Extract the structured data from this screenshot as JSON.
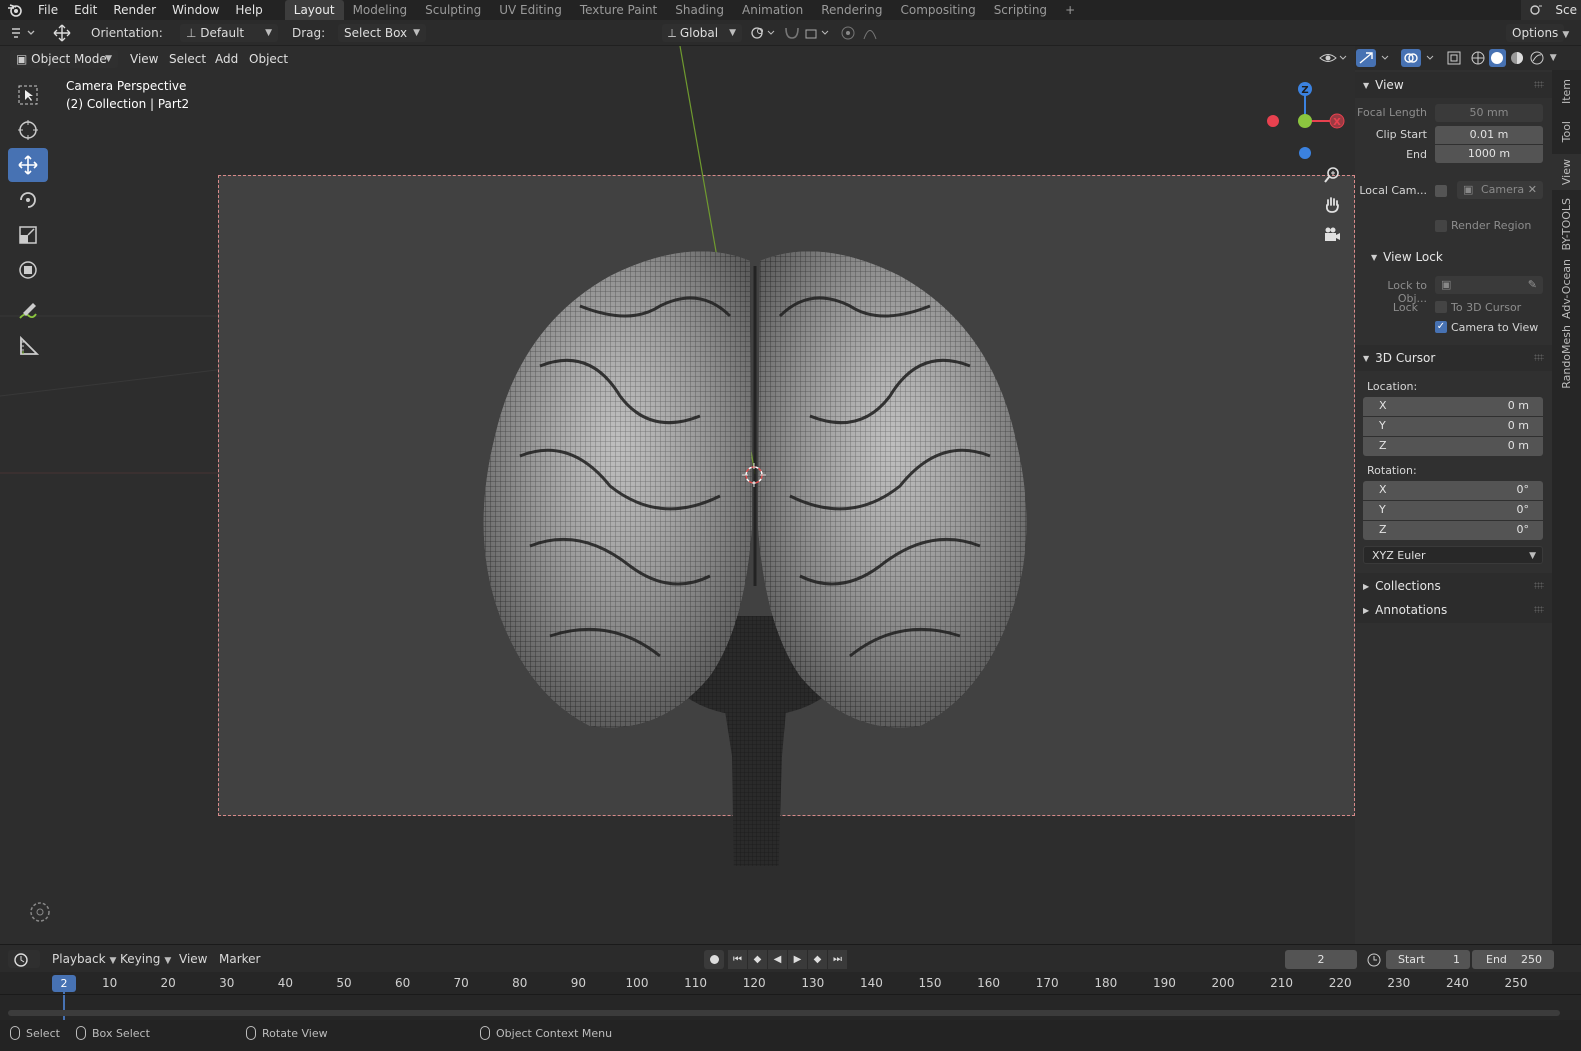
{
  "topbar": {
    "menus": [
      "File",
      "Edit",
      "Render",
      "Window",
      "Help"
    ],
    "workspace_tabs": [
      "Layout",
      "Modeling",
      "Sculpting",
      "UV Editing",
      "Texture Paint",
      "Shading",
      "Animation",
      "Rendering",
      "Compositing",
      "Scripting"
    ],
    "active_tab": "Layout",
    "scene_label": "Sce"
  },
  "toolheader": {
    "orientation_label": "Orientation:",
    "orientation_value": "Default",
    "drag_label": "Drag:",
    "drag_value": "Select Box",
    "transform_orientation": "Global",
    "options_label": "Options"
  },
  "viewport_header": {
    "mode": "Object Mode",
    "menus": [
      "View",
      "Select",
      "Add",
      "Object"
    ]
  },
  "viewport": {
    "overlay_line1": "Camera Perspective",
    "overlay_line2": "(2) Collection | Part2",
    "gizmo_axes": [
      "Z",
      "X"
    ]
  },
  "sidebar": {
    "view_panel": {
      "title": "View",
      "focal_length_label": "Focal Length",
      "focal_length_value": "50 mm",
      "clip_start_label": "Clip Start",
      "clip_start_value": "0.01 m",
      "end_label": "End",
      "end_value": "1000 m",
      "local_camera_label": "Local Cam...",
      "local_camera_value": "Camera",
      "render_region_label": "Render Region"
    },
    "view_lock": {
      "title": "View Lock",
      "lock_to_object_label": "Lock to Obj...",
      "lock_label": "Lock",
      "to_3d_cursor_label": "To 3D Cursor",
      "camera_to_view_label": "Camera to View",
      "camera_to_view_checked": true
    },
    "cursor_panel": {
      "title": "3D Cursor",
      "location_label": "Location:",
      "location": [
        {
          "axis": "X",
          "value": "0 m"
        },
        {
          "axis": "Y",
          "value": "0 m"
        },
        {
          "axis": "Z",
          "value": "0 m"
        }
      ],
      "rotation_label": "Rotation:",
      "rotation": [
        {
          "axis": "X",
          "value": "0°"
        },
        {
          "axis": "Y",
          "value": "0°"
        },
        {
          "axis": "Z",
          "value": "0°"
        }
      ],
      "rotation_mode": "XYZ Euler"
    },
    "collapsed_panels": [
      "Collections",
      "Annotations"
    ]
  },
  "side_tabs": [
    "Item",
    "Tool",
    "View",
    "BY-TOOLS",
    "Adv-Ocean",
    "RandoMesh"
  ],
  "timeline_header": {
    "menus": [
      "Playback",
      "Keying",
      "View",
      "Marker"
    ],
    "current_frame": "2",
    "start_label": "Start",
    "start_value": "1",
    "end_label": "End",
    "end_value": "250"
  },
  "timeline": {
    "current_frame_badge": "2",
    "ticks": [
      "10",
      "20",
      "30",
      "40",
      "50",
      "60",
      "70",
      "80",
      "90",
      "100",
      "110",
      "120",
      "130",
      "140",
      "150",
      "160",
      "170",
      "180",
      "190",
      "200",
      "210",
      "220",
      "230",
      "240",
      "250"
    ]
  },
  "statusbar": {
    "select": "Select",
    "box_select": "Box Select",
    "rotate_view": "Rotate View",
    "context_menu": "Object Context Menu"
  },
  "colors": {
    "accent": "#4772b3",
    "x_axis": "#e8414f",
    "y_axis": "#8bc53f",
    "z_axis": "#3b82e0"
  }
}
